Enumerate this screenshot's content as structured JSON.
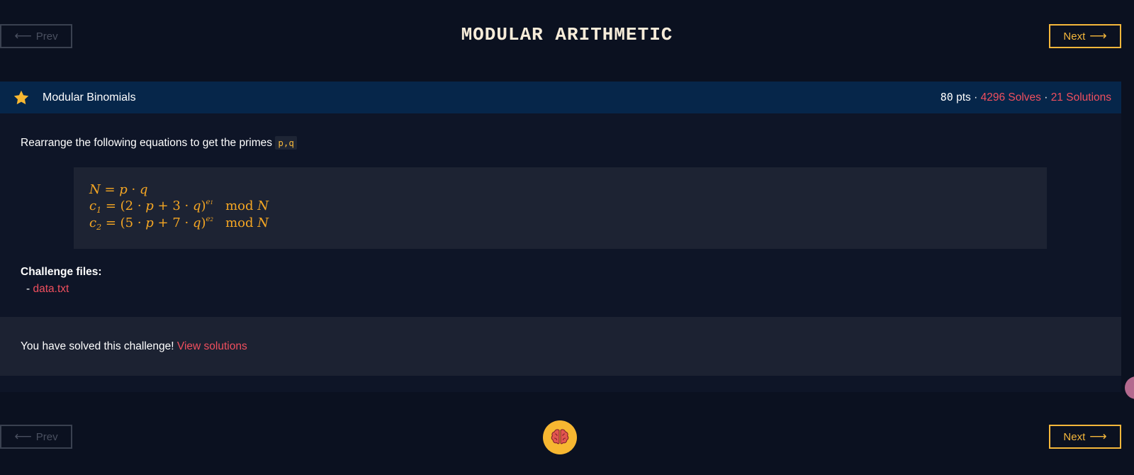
{
  "header": {
    "title": "MODULAR ARITHMETIC",
    "prev_label": "Prev",
    "next_label": "Next"
  },
  "challenge": {
    "star_icon": "star-icon",
    "name": "Modular Binomials",
    "points": "80",
    "points_unit": "pts",
    "separator": "·",
    "solves": "4296 Solves",
    "solutions": "21 Solutions",
    "description": "Rearrange the following equations to get the primes",
    "primes_code": "p,q",
    "equations": {
      "line1": "N = p · q",
      "line2": "c1 = (2 · p + 3 · q)^e1 mod N",
      "line3": "c2 = (5 · p + 7 · q)^e2 mod N"
    },
    "files_heading": "Challenge files:",
    "file_dash": "-",
    "file_name": "data.txt",
    "solved_message": "You have solved this challenge!",
    "view_solutions": "View solutions"
  },
  "footer": {
    "prev_label": "Prev",
    "next_label": "Next",
    "brain_icon": "brain-icon"
  },
  "colors": {
    "background": "#0b1120",
    "accent": "#f5b73b",
    "link": "#f04f5e",
    "header_bar": "#06264a"
  }
}
